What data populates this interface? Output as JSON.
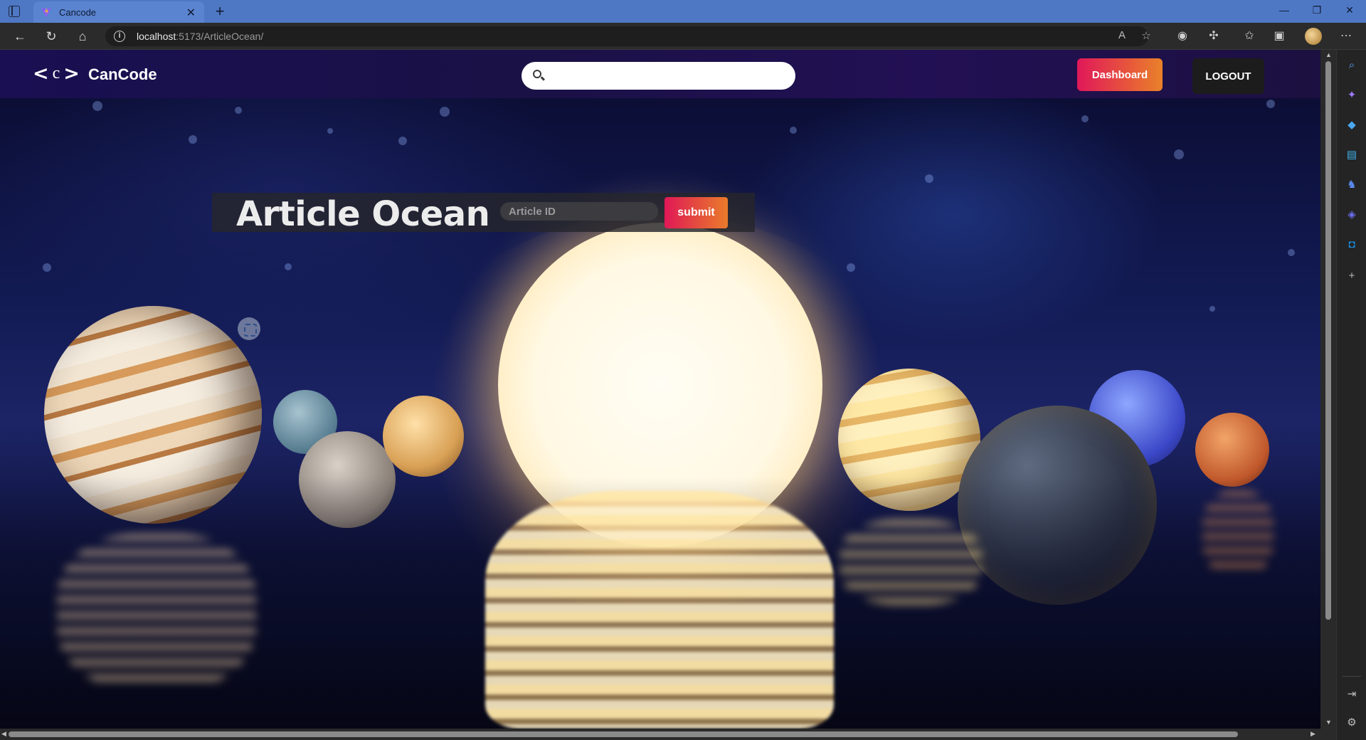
{
  "browser": {
    "tab_title": "Cancode",
    "new_tab_symbol": "+",
    "url_host": "localhost",
    "url_rest": ":5173/ArticleOcean/"
  },
  "header": {
    "logo_mark_left": "<",
    "logo_mark_center": "c",
    "logo_mark_right": ">",
    "logo_text": "CanCode",
    "search_placeholder": "",
    "dashboard_label": "Dashboard",
    "logout_label": "LOGOUT"
  },
  "article_ocean": {
    "title": "Article Ocean",
    "id_placeholder": "Article ID",
    "submit_label": "submit"
  },
  "colors": {
    "accent_gradient_start": "#e0185a",
    "accent_gradient_end": "#e9822a",
    "header_bg": "#1a1146",
    "browser_chrome": "#4f78c4"
  },
  "icons": {
    "sidebar": [
      "search-icon",
      "copilot-icon",
      "shopping-tag-icon",
      "toolbox-icon",
      "games-icon",
      "office-icon",
      "outlook-icon",
      "add-icon"
    ]
  }
}
